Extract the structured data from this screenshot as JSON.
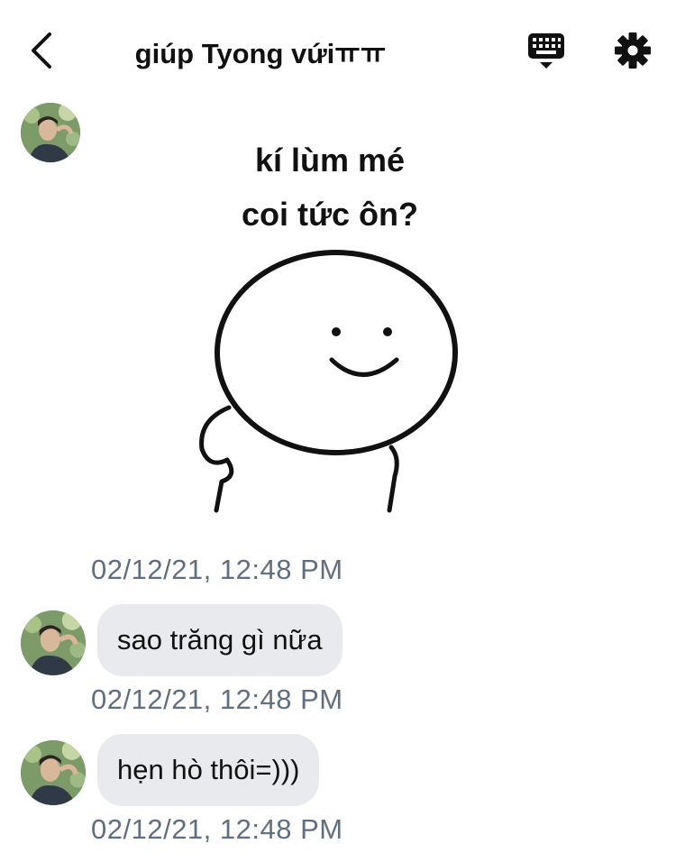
{
  "header": {
    "title": "giúp Tyong vứiㅠㅠ",
    "back_icon": "chevron-left-icon",
    "keyboard_icon": "keyboard-icon",
    "settings_icon": "gear-icon"
  },
  "messages": [
    {
      "type": "sticker",
      "sticker_text_line1": "kí lùm mé",
      "sticker_text_line2": "coi tức ôn?",
      "timestamp": "02/12/21, 12:48 PM"
    },
    {
      "type": "text",
      "text": "sao trăng gì nữa",
      "timestamp": "02/12/21, 12:48 PM"
    },
    {
      "type": "text",
      "text": "hẹn hò thôi=)))",
      "timestamp": "02/12/21, 12:48 PM"
    }
  ],
  "colors": {
    "bubble": "#e8eaed",
    "timestamp": "#5f6f80",
    "text": "#111111"
  }
}
